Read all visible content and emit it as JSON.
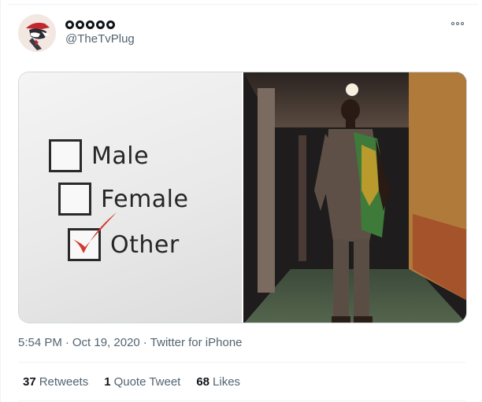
{
  "author": {
    "display_name_glyphs": 5,
    "handle": "@TheTvPlug",
    "avatar": "avatar-image"
  },
  "menu": {
    "icon": "more-icon"
  },
  "media": {
    "left_image": {
      "options": [
        {
          "label": "Male",
          "checked": false
        },
        {
          "label": "Female",
          "checked": false
        },
        {
          "label": "Other",
          "checked": true
        }
      ],
      "check_color": "#d23a2e"
    },
    "right_image": {
      "subject": "man-in-suit-photo"
    }
  },
  "meta": {
    "time": "5:54 PM",
    "separator": "·",
    "date": "Oct 19, 2020",
    "source": "Twitter for iPhone"
  },
  "stats": {
    "retweets_count": "37",
    "retweets_label": "Retweets",
    "quotes_count": "1",
    "quotes_label": "Quote Tweet",
    "likes_count": "68",
    "likes_label": "Likes"
  },
  "colors": {
    "text_primary": "#0f1419",
    "text_secondary": "#536471",
    "border": "#cfd9de"
  }
}
